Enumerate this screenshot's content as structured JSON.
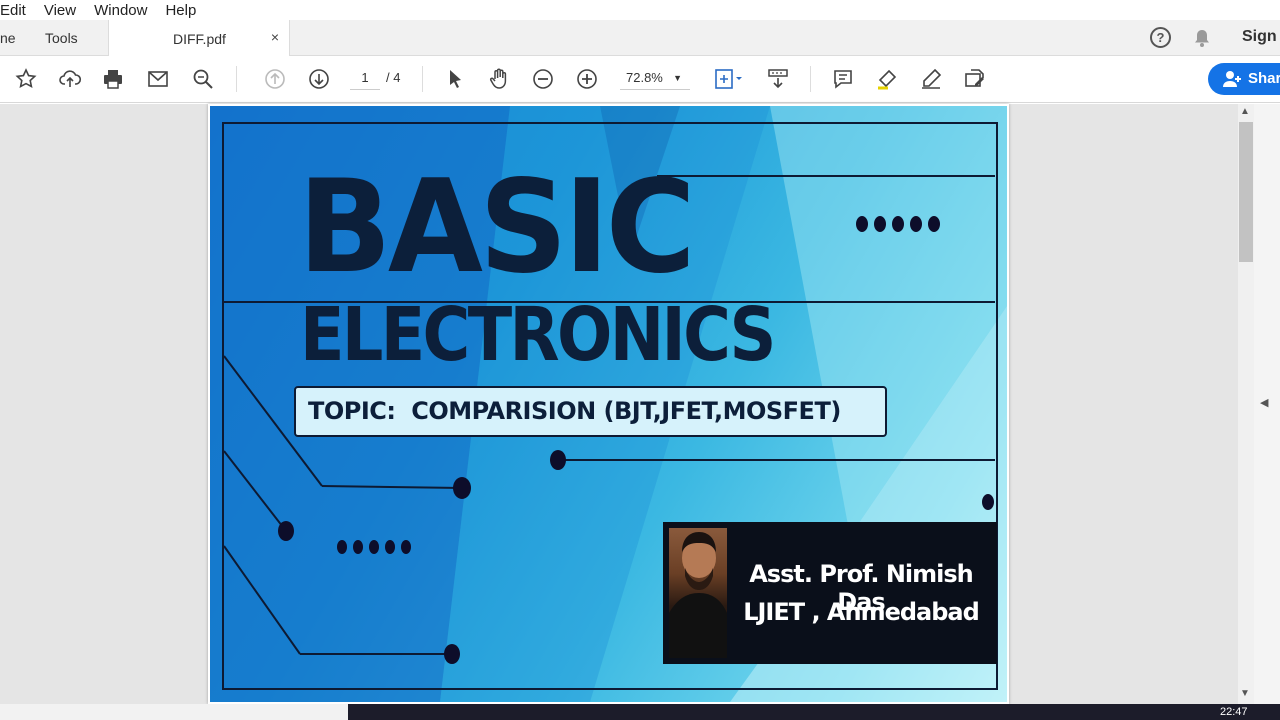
{
  "menu": {
    "edit": "Edit",
    "view": "View",
    "window": "Window",
    "help": "Help"
  },
  "tabs": {
    "home": "ne",
    "tools": "Tools",
    "document": "DIFF.pdf",
    "close": "×"
  },
  "header": {
    "help": "?",
    "signin": "Sign"
  },
  "toolbar": {
    "page_current": "1",
    "page_total": "/ 4",
    "zoom": "72.8%",
    "share_label": "Shar"
  },
  "slide": {
    "title_line1": "BASIC",
    "title_line2": "ELECTRONICS",
    "topic": "TOPIC:  COMPARISION (BJT,JFET,MOSFET)",
    "author_line1": "Asst. Prof. Nimish Das",
    "author_line2": "LJIET , Ahmedabad"
  },
  "taskbar": {
    "clock": "22:47"
  },
  "colors": {
    "accent": "#1473e6",
    "slide_text": "#0c1f3a"
  }
}
